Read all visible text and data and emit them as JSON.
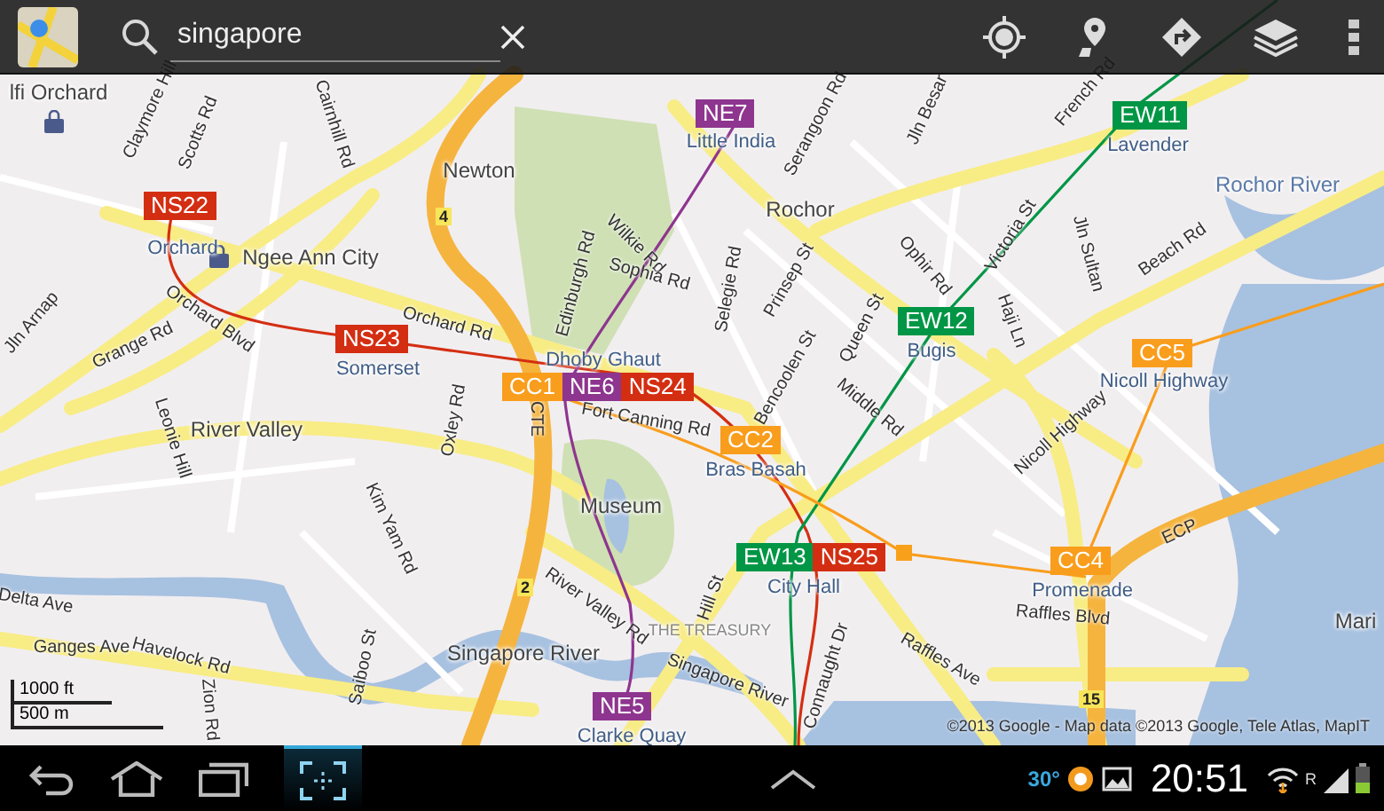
{
  "search": {
    "query": "singapore"
  },
  "map": {
    "stations": [
      {
        "name": "Orchard",
        "lines": [
          {
            "code": "NS22",
            "color": "#d42e12"
          }
        ]
      },
      {
        "name": "Somerset",
        "lines": [
          {
            "code": "NS23",
            "color": "#d42e12"
          }
        ]
      },
      {
        "name": "Dhoby Ghaut",
        "lines": [
          {
            "code": "CC1",
            "color": "#f99d1c"
          },
          {
            "code": "NE6",
            "color": "#8e358f"
          },
          {
            "code": "NS24",
            "color": "#d42e12"
          }
        ]
      },
      {
        "name": "Little India",
        "lines": [
          {
            "code": "NE7",
            "color": "#8e358f"
          }
        ]
      },
      {
        "name": "Lavender",
        "lines": [
          {
            "code": "EW11",
            "color": "#009645"
          }
        ]
      },
      {
        "name": "Bugis",
        "lines": [
          {
            "code": "EW12",
            "color": "#009645"
          }
        ]
      },
      {
        "name": "Nicoll Highway",
        "lines": [
          {
            "code": "CC5",
            "color": "#f99d1c"
          }
        ]
      },
      {
        "name": "Bras Basah",
        "lines": [
          {
            "code": "CC2",
            "color": "#f99d1c"
          }
        ]
      },
      {
        "name": "City Hall",
        "lines": [
          {
            "code": "EW13",
            "color": "#009645"
          },
          {
            "code": "NS25",
            "color": "#d42e12"
          }
        ]
      },
      {
        "name": "Promenade",
        "lines": [
          {
            "code": "CC4",
            "color": "#f99d1c"
          }
        ]
      },
      {
        "name": "Clarke Quay",
        "lines": [
          {
            "code": "NE5",
            "color": "#8e358f"
          }
        ]
      }
    ],
    "places": [
      {
        "name": "lfi Orchard",
        "kind": "place"
      },
      {
        "name": "Ngee Ann City",
        "kind": "shop"
      },
      {
        "name": "Newton",
        "kind": "place"
      },
      {
        "name": "Rochor",
        "kind": "place"
      },
      {
        "name": "Rochor River",
        "kind": "water"
      },
      {
        "name": "River Valley",
        "kind": "place"
      },
      {
        "name": "Museum",
        "kind": "place"
      },
      {
        "name": "THE TREASURY",
        "kind": "landmark"
      },
      {
        "name": "Singapore River",
        "kind": "place"
      },
      {
        "name": "Mari",
        "kind": "place"
      }
    ],
    "roads": [
      "Claymore Hill",
      "Scotts Rd",
      "Cairnhill Rd",
      "Orchard Blvd",
      "Orchard Rd",
      "Grange Rd",
      "Jln Arnap",
      "Edinburgh Rd",
      "Wilkie Rd",
      "Sophia Rd",
      "Serangoon Rd",
      "Jln Besar",
      "French Rd",
      "Victoria St",
      "Jln Sultan",
      "Ophir Rd",
      "Haji Ln",
      "Beach Rd",
      "Selegie Rd",
      "Prinsep St",
      "Queen St",
      "Bencoolen St",
      "Middle Rd",
      "Nicoll Highway",
      "Fort Canning Rd",
      "CTE",
      "Leonie Hill",
      "Oxley Rd",
      "Kim Yam Rd",
      "Delta Ave",
      "Ganges Ave",
      "Havelock Rd",
      "Zion Rd",
      "Saiboo St",
      "River Valley Rd",
      "Hill St",
      "Raffles Blvd",
      "Raffles Ave",
      "Connaught Dr",
      "ECP",
      "Singapore River"
    ],
    "route_shields": [
      "4",
      "2",
      "15"
    ],
    "scale": [
      "1000 ft",
      "500 m"
    ],
    "attribution": "©2013 Google - Map data ©2013 Google, Tele Atlas, MapIT"
  },
  "status_bar": {
    "temperature": "30°",
    "time": "20:51",
    "roaming": "R"
  }
}
